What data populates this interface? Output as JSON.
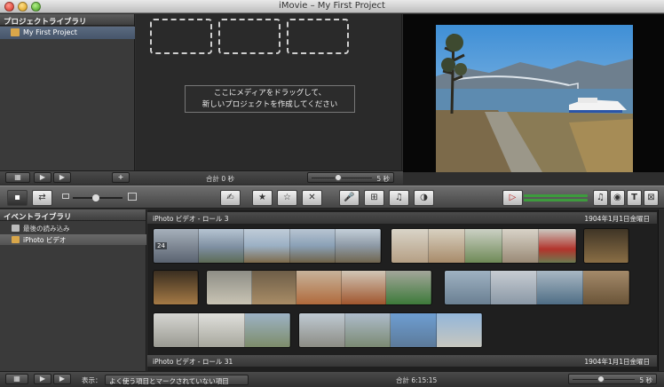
{
  "window": {
    "title": "iMovie – My First Project"
  },
  "project_library": {
    "header": "プロジェクトライブラリ",
    "items": [
      {
        "label": "My First Project"
      }
    ]
  },
  "project_editor": {
    "drop_text_line1": "ここにメディアをドラッグして、",
    "drop_text_line2": "新しいプロジェクトを作成してください"
  },
  "project_bar": {
    "total": "合計 0 秒",
    "zoom_value": "5 秒"
  },
  "event_library": {
    "header": "イベントライブラリ",
    "items": [
      {
        "label": "最後の読み込み"
      },
      {
        "label": "iPhoto ビデオ"
      }
    ]
  },
  "event_browser": {
    "rolls": [
      {
        "title": "iPhoto ビデオ - ロール 3",
        "date": "1904年1月1日金曜日"
      },
      {
        "title": "iPhoto ビデオ - ロール 31",
        "date": "1904年1月1日金曜日"
      }
    ],
    "first_clip_badge": "24"
  },
  "bottom_bar": {
    "display_label": "表示：",
    "display_select": "よく使う項目とマークされていない項目",
    "total": "合計 6:15:15",
    "zoom_value": "5 秒"
  }
}
